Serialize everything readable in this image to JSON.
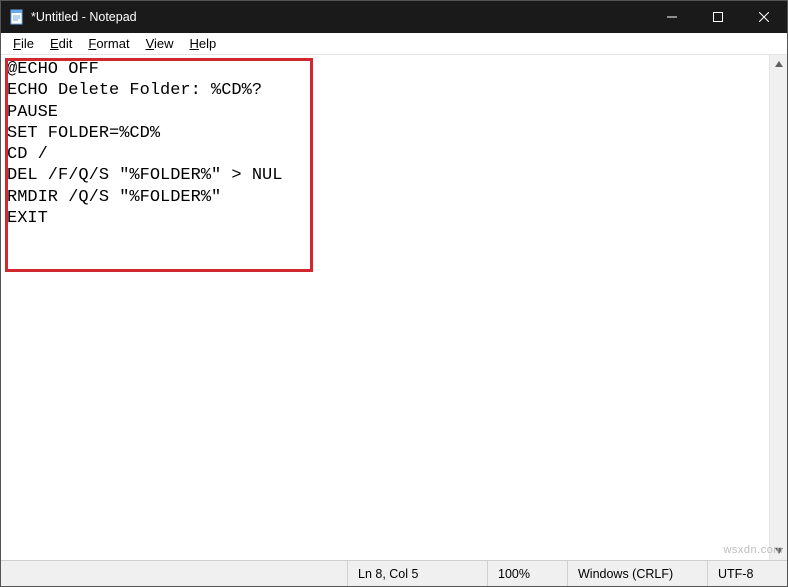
{
  "titlebar": {
    "title": "*Untitled - Notepad"
  },
  "menubar": {
    "items": [
      "File",
      "Edit",
      "Format",
      "View",
      "Help"
    ]
  },
  "editor": {
    "content": "@ECHO OFF\nECHO Delete Folder: %CD%?\nPAUSE\nSET FOLDER=%CD%\nCD /\nDEL /F/Q/S \"%FOLDER%\" > NUL\nRMDIR /Q/S \"%FOLDER%\"\nEXIT"
  },
  "statusbar": {
    "cursor": "Ln 8, Col 5",
    "zoom": "100%",
    "line_ending": "Windows (CRLF)",
    "encoding": "UTF-8"
  },
  "annotation": {
    "highlight_color": "#d1282f"
  },
  "watermark": "wsxdn.com"
}
